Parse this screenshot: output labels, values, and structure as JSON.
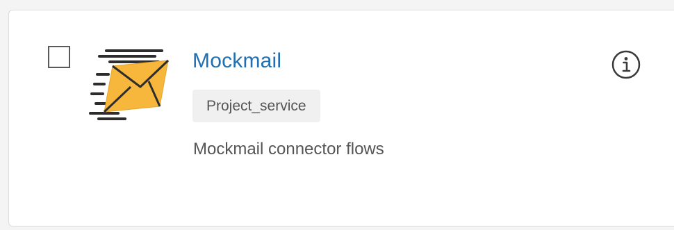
{
  "card": {
    "title": "Mockmail",
    "tag": "Project_service",
    "description": "Mockmail connector flows",
    "checkbox_checked": false
  },
  "icons": {
    "logo": "envelope-mail-icon",
    "info": "info-icon"
  },
  "colors": {
    "title": "#1f6fb2",
    "envelope": "#f6b73c",
    "text": "#555555"
  }
}
